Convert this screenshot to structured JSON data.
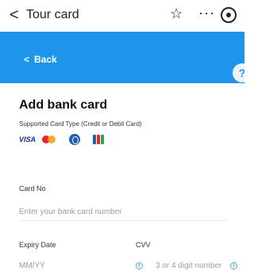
{
  "topbar": {
    "back_glyph": "<",
    "title": "Tour card",
    "star_glyph": "☆",
    "more_glyph": "···"
  },
  "header": {
    "back_label": "Back",
    "back_glyph": "<",
    "help_glyph": "?"
  },
  "form": {
    "title": "Add bank card",
    "supported_text": "Supported Card Type (Credit or Debit Card)",
    "card_brands": [
      "VISA",
      "Mastercard",
      "Diners",
      "JCB"
    ],
    "visa_text": "VISA",
    "card_no": {
      "label": "Card No",
      "placeholder": "Enter your bank card number"
    },
    "expiry": {
      "label": "Expiry Date",
      "placeholder": "MM/YY",
      "info_glyph": "i"
    },
    "cvv": {
      "label": "CVV",
      "placeholder": "3 or 4 digit number",
      "info_glyph": "i"
    }
  },
  "colors": {
    "header_blue": "#1f95e9",
    "info_blue": "#45a6ef"
  }
}
